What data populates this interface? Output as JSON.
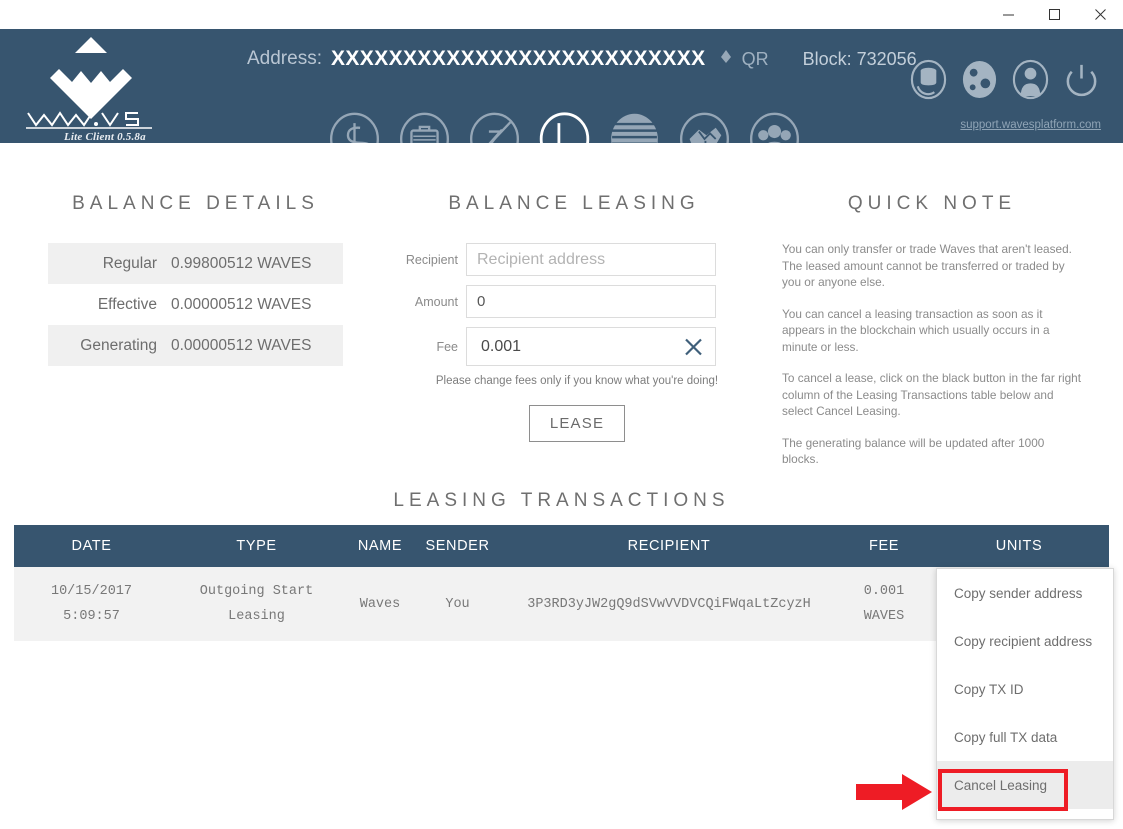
{
  "window": {
    "minimize_label": "Minimize",
    "maximize_label": "Maximize",
    "close_label": "Close"
  },
  "header": {
    "logo_name": "WAVES",
    "logo_subtitle": "Lite Client 0.5.8a",
    "address_label": "Address:",
    "address_value": "XXXXXXXXXXXXXXXXXXXXXXXXXX",
    "qr_label": "QR",
    "block_label": "Block: 732056",
    "support_link": "support.wavesplatform.com",
    "nav_icons": [
      {
        "name": "wallet-icon",
        "title": "Wallet"
      },
      {
        "name": "portfolio-icon",
        "title": "Portfolio"
      },
      {
        "name": "exchange-icon",
        "title": "Exchange"
      },
      {
        "name": "leasing-icon",
        "title": "Leasing",
        "active": true
      },
      {
        "name": "tokens-icon",
        "title": "Tokens"
      },
      {
        "name": "map-icon",
        "title": "Map"
      },
      {
        "name": "community-icon",
        "title": "Community"
      }
    ],
    "top_icons": [
      {
        "name": "database-sync-icon",
        "title": "Sync"
      },
      {
        "name": "settings-globe-icon",
        "title": "Settings"
      },
      {
        "name": "user-profile-icon",
        "title": "Profile"
      },
      {
        "name": "power-icon",
        "title": "Logout"
      }
    ],
    "accent_color": "#37556f"
  },
  "balance_details": {
    "title": "BALANCE DETAILS",
    "rows": [
      {
        "name": "Regular",
        "value": "0.99800512 WAVES"
      },
      {
        "name": "Effective",
        "value": "0.00000512 WAVES"
      },
      {
        "name": "Generating",
        "value": "0.00000512 WAVES"
      }
    ]
  },
  "balance_leasing": {
    "title": "BALANCE LEASING",
    "recipient_label": "Recipient",
    "recipient_placeholder": "Recipient address",
    "recipient_value": "",
    "amount_label": "Amount",
    "amount_value": "0",
    "fee_label": "Fee",
    "fee_value": "0.001",
    "clear_icon": "close-icon",
    "fee_note": "Please change fees only if you know what you're doing!",
    "lease_button": "LEASE"
  },
  "quick_note": {
    "title": "QUICK NOTE",
    "paragraphs": [
      "You can only transfer or trade Waves that aren't leased. The leased amount cannot be transferred or traded by you or anyone else.",
      "You can cancel a leasing transaction as soon as it appears in the blockchain which usually occurs in a minute or less.",
      "To cancel a lease, click on the black button in the far right column of the Leasing Transactions table below and select Cancel Leasing.",
      "The generating balance will be updated after 1000 blocks."
    ]
  },
  "leasing_transactions": {
    "title": "LEASING TRANSACTIONS",
    "columns": [
      "DATE",
      "TYPE",
      "NAME",
      "SENDER",
      "RECIPIENT",
      "FEE",
      "UNITS"
    ],
    "rows": [
      {
        "date_line1": "10/15/2017",
        "date_line2": "5:09:57",
        "type_line1": "Outgoing Start",
        "type_line2": "Leasing",
        "name": "Waves",
        "sender": "You",
        "recipient": "3P3RD3yJW2gQ9dSVwVVDVCQiFWqaLtZcyzH",
        "fee_line1": "0.001",
        "fee_line2": "WAVES",
        "units": ""
      }
    ]
  },
  "context_menu": {
    "items": [
      {
        "label": "Copy sender address",
        "highlighted": false
      },
      {
        "label": "Copy recipient address",
        "highlighted": false
      },
      {
        "label": "Copy TX ID",
        "highlighted": false
      },
      {
        "label": "Copy full TX data",
        "highlighted": false
      },
      {
        "label": "Cancel Leasing",
        "highlighted": true
      }
    ]
  },
  "annotation": {
    "color": "#ee1c25",
    "arrow_name": "red-arrow-annotation",
    "box_name": "red-highlight-box"
  }
}
